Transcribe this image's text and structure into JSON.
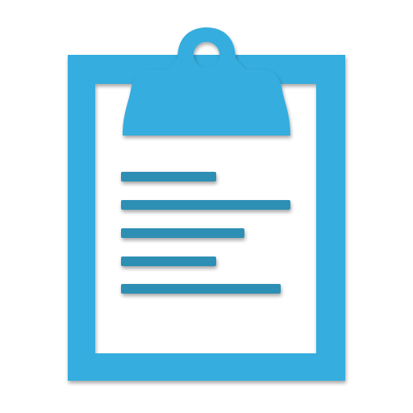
{
  "icon": {
    "name": "clipboard-icon",
    "color": "#35ADDE",
    "line_color": "#2E8FB4",
    "background": "#FFFFFF"
  }
}
